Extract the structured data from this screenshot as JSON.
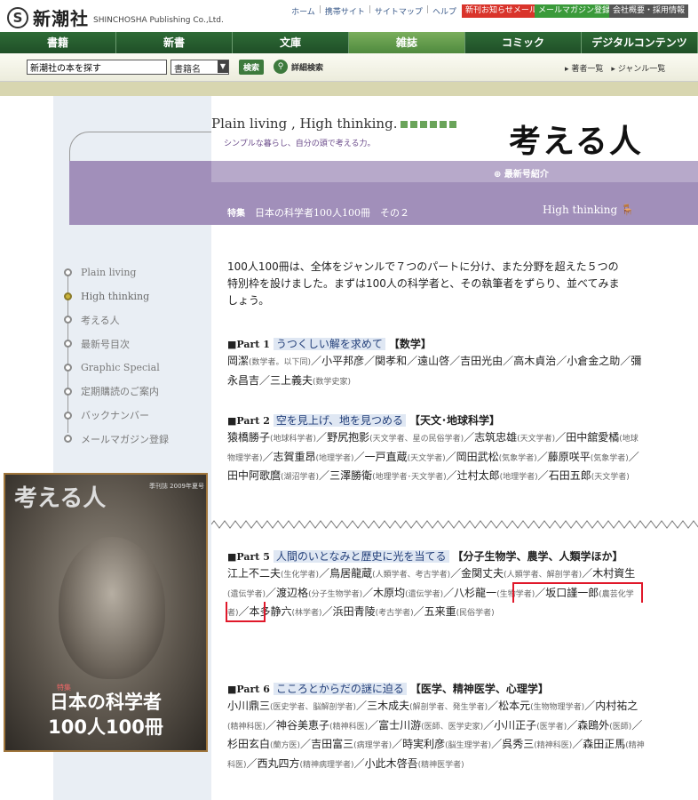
{
  "header": {
    "logo_text": "新潮社",
    "logo_mark": "S",
    "logo_en": "SHINCHOSHA Publishing Co.,Ltd.",
    "util_links": [
      "ホーム",
      "携帯サイト",
      "サイトマップ",
      "ヘルプ"
    ],
    "btn_new_mail": "新刊お知らせメール",
    "btn_magazine": "メールマガジン登録",
    "btn_company": "会社概要・採用情報"
  },
  "nav": {
    "items": [
      "書籍",
      "新書",
      "文庫",
      "雑誌",
      "コミック",
      "デジタルコンテンツ"
    ],
    "active_index": 3
  },
  "search": {
    "input_value": "新潮社の本を探す",
    "select_value": "書籍名",
    "button_label": "検索",
    "advanced_label": "詳細検索",
    "quick_links": "▸ 著者一覧　▸ ジャンル一覧"
  },
  "magazine": {
    "tagline_en": "Plain living , High thinking.",
    "tagline_jp": "シンプルな暮らし、自分の頭で考える力。",
    "brand": "考える人",
    "newest_label": "最新号紹介",
    "feature_prefix": "特集",
    "feature_title": "日本の科学者100人100冊　その２",
    "section_label": "High thinking"
  },
  "leftnav": {
    "items": [
      "Plain living",
      "High thinking",
      "考える人",
      "最新号目次",
      "Graphic Special",
      "定期購読のご案内",
      "バックナンバー",
      "メールマガジン登録"
    ],
    "active_index": 1
  },
  "cover": {
    "logo": "考える人",
    "issue": "季刊誌 2009年夏号",
    "feature_tag": "特集",
    "title_line1": "日本の科学者",
    "title_line2": "100人100冊"
  },
  "intro": "100人100冊は、全体をジャンルで７つのパートに分け、また分野を超えた５つの特別枠を設けました。まずは100人の科学者と、その執筆者をずらり、並べてみましょう。",
  "parts": [
    {
      "no": "■Part 1",
      "name": "うつくしい解を求めて",
      "field": "【数学】",
      "body": [
        [
          "岡潔",
          "数学者。以下同"
        ],
        [
          "小平邦彦",
          ""
        ],
        [
          "関孝和",
          ""
        ],
        [
          "遠山啓",
          ""
        ],
        [
          "吉田光由",
          ""
        ],
        [
          "高木貞治",
          ""
        ],
        [
          "小倉金之助",
          ""
        ],
        [
          "彌永昌吉",
          ""
        ],
        [
          "三上義夫",
          "数学史家"
        ]
      ]
    },
    {
      "no": "■Part 2",
      "name": "空を見上げ、地を見つめる",
      "field": "【天文･地球科学】",
      "body": [
        [
          "猿橋勝子",
          "地球科学者"
        ],
        [
          "野尻抱影",
          "天文学者、星の民俗学者"
        ],
        [
          "志筑忠雄",
          "天文学者"
        ],
        [
          "田中舘愛橘",
          "地球物理学者"
        ],
        [
          "志賀重昂",
          "地理学者"
        ],
        [
          "一戸直蔵",
          "天文学者"
        ],
        [
          "岡田武松",
          "気象学者"
        ],
        [
          "藤原咲平",
          "気象学者"
        ],
        [
          "田中阿歌麿",
          "湖沼学者"
        ],
        [
          "三澤勝衛",
          "地理学者･天文学者"
        ],
        [
          "辻村太郎",
          "地理学者"
        ],
        [
          "石田五郎",
          "天文学者"
        ]
      ]
    },
    {
      "no": "■Part 5",
      "name": "人間のいとなみと歴史に光を当てる",
      "field": "【分子生物学、農学、人類学ほか】",
      "body": [
        [
          "江上不二夫",
          "生化学者"
        ],
        [
          "鳥居龍蔵",
          "人類学者、考古学者"
        ],
        [
          "金関丈夫",
          "人類学者、解剖学者"
        ],
        [
          "木村資生",
          "遺伝学者"
        ],
        [
          "渡辺格",
          "分子生物学者"
        ],
        [
          "木原均",
          "遺伝学者"
        ],
        [
          "八杉龍一",
          "生物学者"
        ],
        [
          "坂口謹一郎",
          "農芸化学者"
        ],
        [
          "本多静六",
          "林学者"
        ],
        [
          "浜田青陵",
          "考古学者"
        ],
        [
          "五来重",
          "民俗学者"
        ]
      ]
    },
    {
      "no": "■Part 6",
      "name": "こころとからだの謎に迫る",
      "field": "【医学、精神医学、心理学】",
      "body": [
        [
          "小川鼎三",
          "医史学者、脳解剖学者"
        ],
        [
          "三木成夫",
          "解剖学者、発生学者"
        ],
        [
          "松本元",
          "生物物理学者"
        ],
        [
          "内村祐之",
          "精神科医"
        ],
        [
          "神谷美恵子",
          "精神科医"
        ],
        [
          "富士川游",
          "医師、医学史家"
        ],
        [
          "小川正子",
          "医学者"
        ],
        [
          "森鴎外",
          "医師"
        ],
        [
          "杉田玄白",
          "蘭方医"
        ],
        [
          "吉田富三",
          "病理学者"
        ],
        [
          "時実利彦",
          "脳生理学者"
        ],
        [
          "呉秀三",
          "精神科医"
        ],
        [
          "森田正馬",
          "精神科医"
        ],
        [
          "西丸四方",
          "精神病理学者"
        ],
        [
          "小此木啓吾",
          "精神医学者"
        ]
      ]
    }
  ]
}
